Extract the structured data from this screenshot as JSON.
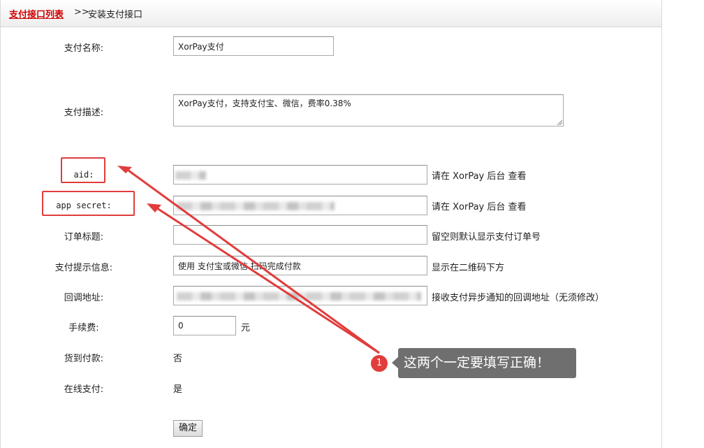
{
  "breadcrumb": {
    "link": "支付接口列表",
    "separator": ">>",
    "current": "安装支付接口"
  },
  "form": {
    "name": {
      "label": "支付名称:",
      "value": "XorPay支付"
    },
    "desc": {
      "label": "支付描述:",
      "value": "XorPay支付，支持支付宝、微信，费率0.38%"
    },
    "aid": {
      "label": "aid:",
      "hint": "请在 XorPay 后台 查看"
    },
    "secret": {
      "label": "app secret:",
      "hint": "请在 XorPay 后台 查看"
    },
    "order_title": {
      "label": "订单标题:",
      "value": "",
      "hint": "留空则默认显示支付订单号"
    },
    "tip": {
      "label": "支付提示信息:",
      "value": "使用 支付宝或微信 扫码完成付款",
      "hint": "显示在二维码下方"
    },
    "callback": {
      "label": "回调地址:",
      "hint": "接收支付异步通知的回调地址（无须修改）"
    },
    "fee": {
      "label": "手续费:",
      "value": "0",
      "unit": "元"
    },
    "cod": {
      "label": "货到付款:",
      "value": "否"
    },
    "online": {
      "label": "在线支付:",
      "value": "是"
    },
    "submit": "确定"
  },
  "annotation": {
    "number": "1",
    "text": "这两个一定要填写正确！"
  },
  "colors": {
    "link_red": "#d00000",
    "annotation_red": "#e23c3c",
    "callout_gray": "#6f6f6f"
  }
}
